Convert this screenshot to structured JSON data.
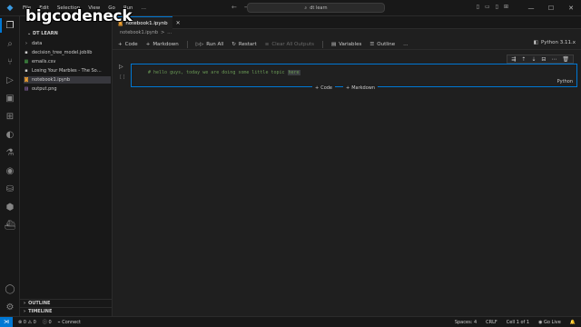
{
  "window": {
    "command_center": "dt learn",
    "menu": [
      "File",
      "Edit",
      "Selection",
      "View",
      "Go",
      "Run",
      "…"
    ]
  },
  "watermark": "bigcodeneck",
  "explorer": {
    "header": "DT LEARN",
    "items": [
      {
        "label": "data",
        "icon": "folder-chevron-icon",
        "color": "#cccccc"
      },
      {
        "label": "decision_tree_model.joblib",
        "icon": "file-icon",
        "color": "#cccccc"
      },
      {
        "label": "emails.csv",
        "icon": "csv-icon",
        "color": "#cccccc"
      },
      {
        "label": "Losing Your Marbles - The So…",
        "icon": "file-icon",
        "color": "#cccccc"
      },
      {
        "label": "notebook1.ipynb",
        "icon": "notebook-icon",
        "color": "#f0a030",
        "selected": true
      },
      {
        "label": "output.png",
        "icon": "image-icon",
        "color": "#cccccc"
      }
    ],
    "outline_label": "OUTLINE",
    "timeline_label": "TIMELINE"
  },
  "editor": {
    "tab_label": "notebook1.ipynb",
    "breadcrumb": [
      "notebook1.ipynb",
      ">",
      "..."
    ],
    "toolbar": {
      "code": "Code",
      "markdown": "Markdown",
      "run_all": "Run All",
      "restart": "Restart",
      "clear_all": "Clear All Outputs",
      "variables": "Variables",
      "outline": "Outline",
      "more": "…"
    },
    "kernel": "Python 3.11.x",
    "cell": {
      "code_prefix": "# hello guys, today we are doing some little topic ",
      "code_highlight": "here",
      "language": "Python",
      "exec_count": "[ ]"
    },
    "add_code": "Code",
    "add_markdown": "Markdown"
  },
  "status": {
    "errors": "0",
    "warnings": "0",
    "info": "0",
    "connect": "Connect",
    "spaces": "Spaces: 4",
    "eol": "CRLF",
    "cell_pos": "Cell 1 of 1",
    "golive": "Go Live"
  }
}
